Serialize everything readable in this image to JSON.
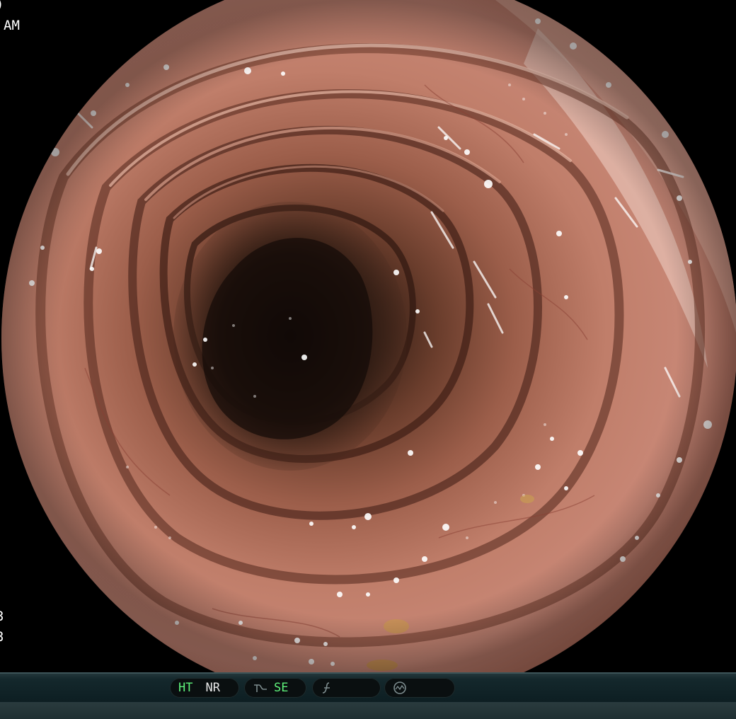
{
  "overlay": {
    "time_suffix": "AM",
    "top_fragment": ")",
    "bottom_fragments": [
      "3",
      "3"
    ]
  },
  "status_bar": {
    "indicators": [
      {
        "label": "HT",
        "color": "#5ef07a"
      },
      {
        "label": "NR",
        "color": "#e6e6e6"
      },
      {
        "label": "SE",
        "color": "#5ef07a"
      }
    ],
    "icons": [
      "structure-enhance-icon",
      "color-function-icon",
      "auto-gain-icon"
    ]
  },
  "colors": {
    "status_bar_bg": "#14282c",
    "indicator_on": "#5ef07a",
    "indicator_plain": "#e6e6e6",
    "icon_dim": "#7d8c8e"
  }
}
